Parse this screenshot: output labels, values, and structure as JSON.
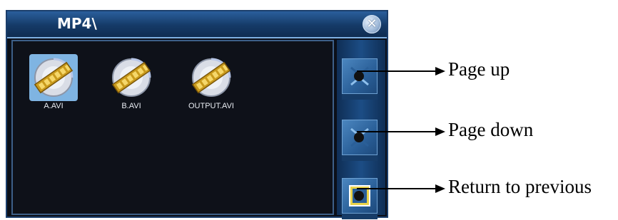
{
  "window": {
    "title": "MP4\\",
    "close_icon": "close-icon"
  },
  "files": [
    {
      "name": "A.AVI",
      "selected": true,
      "icon": "video-file-icon"
    },
    {
      "name": "B.AVI",
      "selected": false,
      "icon": "video-file-icon"
    },
    {
      "name": "OUTPUT.AVI",
      "selected": false,
      "icon": "video-file-icon"
    }
  ],
  "side_buttons": [
    {
      "name": "page-up",
      "icon": "page-up-icon"
    },
    {
      "name": "page-down",
      "icon": "page-down-icon"
    },
    {
      "name": "return-to-previous",
      "icon": "return-icon"
    }
  ],
  "callouts": {
    "page_up": "Page up",
    "page_down": "Page down",
    "return": "Return to previous"
  },
  "colors": {
    "title_bar": "#1b4a80",
    "selection": "#7fb4e2",
    "pane_background": "#0e1119"
  }
}
